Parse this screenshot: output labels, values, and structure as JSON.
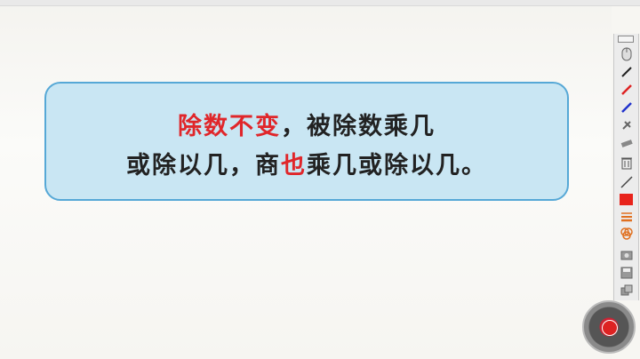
{
  "slide": {
    "line1_red": "除数不变",
    "line1_rest": "，被除数乘几",
    "line2_a": "或除以几，商",
    "line2_red": "也",
    "line2_b": "乘几或除以几。"
  },
  "colors": {
    "highlight": "#e0262a",
    "box_fill": "#c9e6f3",
    "box_border": "#56a8d6"
  },
  "toolbar": {
    "items": [
      "minimize-icon",
      "mouse-icon",
      "pen-black-icon",
      "pen-red-icon",
      "pen-blue-icon",
      "pin-icon",
      "eraser-icon",
      "trash-icon",
      "line-icon",
      "color-red-icon",
      "line-style-icon",
      "shapes-icon",
      "screenshot-icon",
      "save-icon",
      "settings-icon"
    ]
  }
}
